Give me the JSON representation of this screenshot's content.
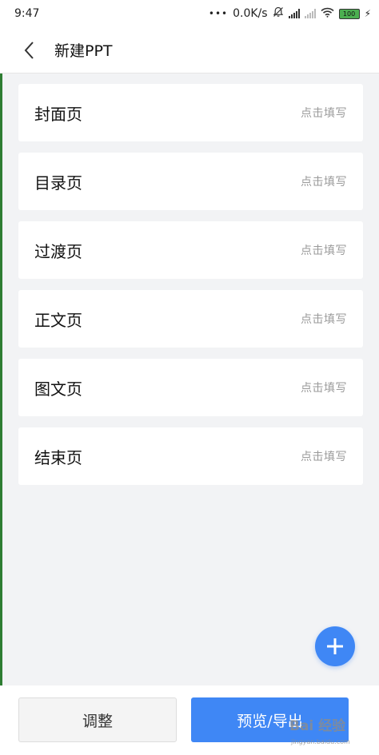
{
  "status_bar": {
    "time": "9:47",
    "dots": "•••",
    "speed": "0.0K/s",
    "battery": "100",
    "icons": [
      "mute-bell-icon",
      "signal-icon",
      "signal-weak-icon",
      "wifi-icon",
      "battery-icon",
      "charging-icon"
    ]
  },
  "header": {
    "title": "新建PPT",
    "back_icon": "chevron-left-icon"
  },
  "pages": [
    {
      "label": "封面页",
      "hint": "点击填写"
    },
    {
      "label": "目录页",
      "hint": "点击填写"
    },
    {
      "label": "过渡页",
      "hint": "点击填写"
    },
    {
      "label": "正文页",
      "hint": "点击填写"
    },
    {
      "label": "图文页",
      "hint": "点击填写"
    },
    {
      "label": "结束页",
      "hint": "点击填写"
    }
  ],
  "fab": {
    "icon": "plus-icon"
  },
  "bottom": {
    "adjust_label": "调整",
    "preview_label": "预览/导出"
  },
  "watermark": {
    "brand": "Bai 经验",
    "sub": "jingyan.baidu.com"
  },
  "colors": {
    "accent": "#3f87f5",
    "background": "#f2f3f5",
    "hint": "#9a9a9a"
  }
}
